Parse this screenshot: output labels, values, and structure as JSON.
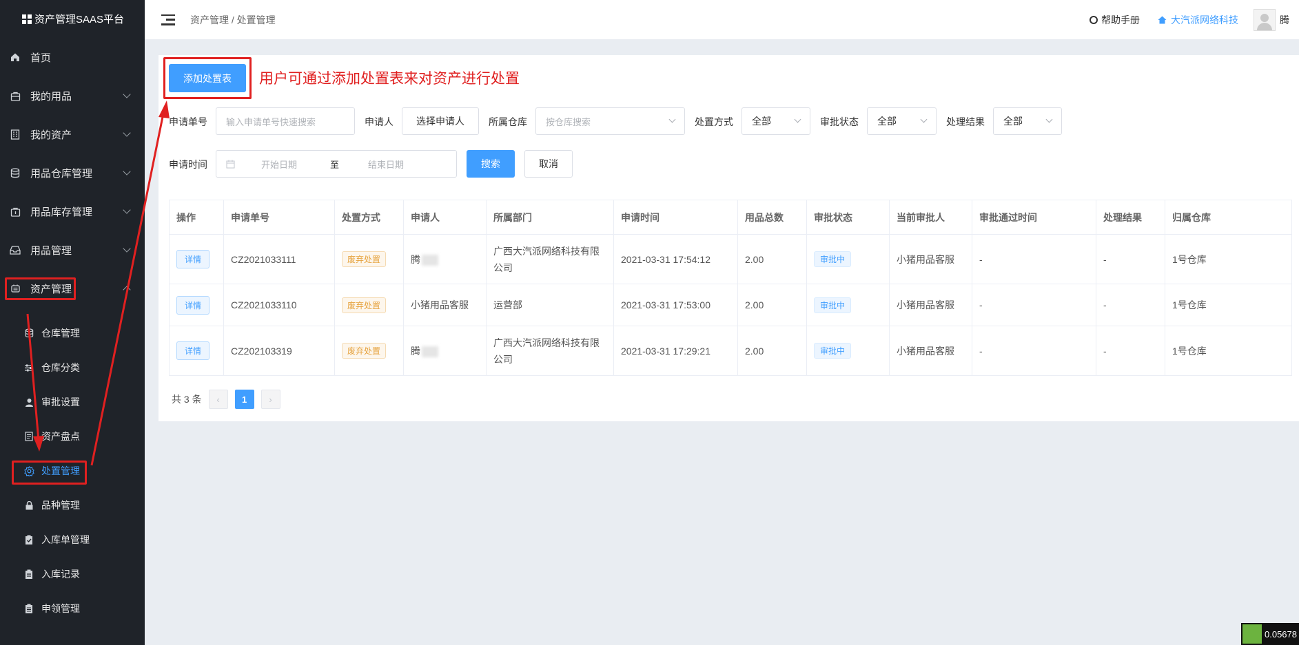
{
  "app": {
    "brand": "资产管理SAAS平台"
  },
  "sidebar": {
    "items": [
      {
        "label": "首页",
        "icon": "home-icon"
      },
      {
        "label": "我的用品",
        "icon": "bag-icon"
      },
      {
        "label": "我的资产",
        "icon": "building-icon"
      },
      {
        "label": "用品仓库管理",
        "icon": "database-icon"
      },
      {
        "label": "用品库存管理",
        "icon": "box-icon"
      },
      {
        "label": "用品管理",
        "icon": "inbox-icon"
      },
      {
        "label": "资产管理",
        "icon": "asset-icon"
      }
    ],
    "subitems": [
      {
        "label": "仓库管理",
        "icon": "database-icon"
      },
      {
        "label": "仓库分类",
        "icon": "sliders-icon"
      },
      {
        "label": "审批设置",
        "icon": "user-icon"
      },
      {
        "label": "资产盘点",
        "icon": "document-icon"
      },
      {
        "label": "处置管理",
        "icon": "gear-icon"
      },
      {
        "label": "品种管理",
        "icon": "lock-icon"
      },
      {
        "label": "入库单管理",
        "icon": "clipboard-check-icon"
      },
      {
        "label": "入库记录",
        "icon": "clipboard-icon"
      },
      {
        "label": "申领管理",
        "icon": "clipboard-list-icon"
      }
    ]
  },
  "header": {
    "breadcrumb": "资产管理 / 处置管理",
    "help": "帮助手册",
    "company": "大汽派网络科技",
    "user_name": "腾"
  },
  "main": {
    "add_button": "添加处置表",
    "annotation": "用户可通过添加处置表来对资产进行处置",
    "filters": {
      "order_label": "申请单号",
      "order_placeholder": "输入申请单号快速搜索",
      "applicant_label": "申请人",
      "applicant_button": "选择申请人",
      "warehouse_label": "所属仓库",
      "warehouse_placeholder": "按仓库搜索",
      "method_label": "处置方式",
      "method_value": "全部",
      "status_label": "审批状态",
      "status_value": "全部",
      "result_label": "处理结果",
      "result_value": "全部",
      "time_label": "申请时间",
      "start_placeholder": "开始日期",
      "range_sep": "至",
      "end_placeholder": "结束日期",
      "search_button": "搜索",
      "cancel_button": "取消"
    },
    "table": {
      "headers": [
        "操作",
        "申请单号",
        "处置方式",
        "申请人",
        "所属部门",
        "申请时间",
        "用品总数",
        "审批状态",
        "当前审批人",
        "审批通过时间",
        "处理结果",
        "归属仓库"
      ],
      "rows": [
        {
          "action": "详情",
          "order": "CZ2021033111",
          "method": "废弃处置",
          "applicant": "腾",
          "dept": "广西大汽派网络科技有限公司",
          "time": "2021-03-31 17:54:12",
          "total": "2.00",
          "status": "审批中",
          "approver": "小猪用品客服",
          "pass_time": "-",
          "result": "-",
          "warehouse": "1号仓库"
        },
        {
          "action": "详情",
          "order": "CZ2021033110",
          "method": "废弃处置",
          "applicant": "小猪用品客服",
          "dept": "运营部",
          "time": "2021-03-31 17:53:00",
          "total": "2.00",
          "status": "审批中",
          "approver": "小猪用品客服",
          "pass_time": "-",
          "result": "-",
          "warehouse": "1号仓库"
        },
        {
          "action": "详情",
          "order": "CZ202103319",
          "method": "废弃处置",
          "applicant": "腾",
          "dept": "广西大汽派网络科技有限公司",
          "time": "2021-03-31 17:29:21",
          "total": "2.00",
          "status": "审批中",
          "approver": "小猪用品客服",
          "pass_time": "-",
          "result": "-",
          "warehouse": "1号仓库"
        }
      ]
    },
    "pagination": {
      "total": "共 3 条",
      "current": "1"
    }
  },
  "corner": {
    "text": "0.05678"
  }
}
